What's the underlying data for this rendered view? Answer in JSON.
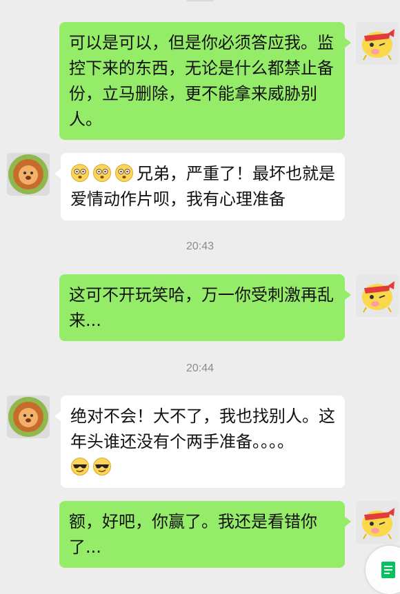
{
  "chat": {
    "messages": [
      {
        "sender": "me",
        "text": "可以是可以，但是你必须答应我。监控下来的东西，无论是什么都禁止备份，立马删除，更不能拿来威胁别人。"
      },
      {
        "sender": "other",
        "emoji_prefix": [
          "dizzy-face-emoji",
          "dizzy-face-emoji",
          "dizzy-face-emoji"
        ],
        "text": "兄弟，严重了！最坏也就是爱情动作片呗，我有心理准备"
      },
      {
        "type": "timestamp",
        "text": "20:43"
      },
      {
        "sender": "me",
        "text": "这可不开玩笑哈，万一你受刺激再乱来..."
      },
      {
        "type": "timestamp",
        "text": "20:44"
      },
      {
        "sender": "other",
        "text": "绝对不会！大不了，我也找别人。这年头谁还没有个两手准备。。。。",
        "emoji_suffix": [
          "cool-sunglasses-emoji",
          "cool-sunglasses-emoji"
        ]
      },
      {
        "sender": "me",
        "text": "额，好吧，你赢了。我还是看错你了..."
      }
    ]
  },
  "avatars": {
    "me": "yellow-chick-avatar",
    "other": "lion-avatar"
  },
  "colors": {
    "background": "#ededed",
    "my_bubble": "#95ec69",
    "other_bubble": "#ffffff",
    "timestamp_text": "#8c8c8c",
    "fab_icon": "#07c160"
  },
  "fab": {
    "icon": "document-icon"
  }
}
